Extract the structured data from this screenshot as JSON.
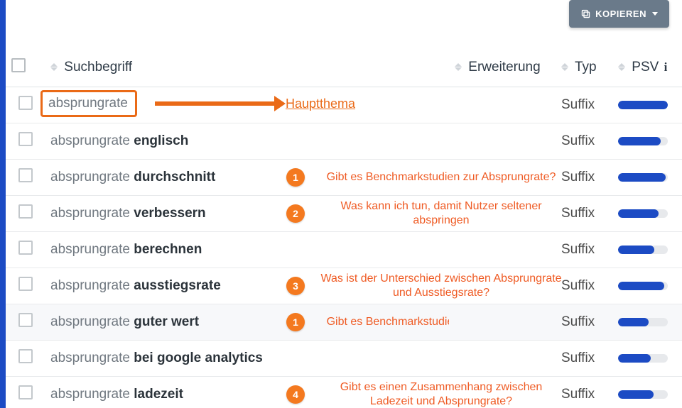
{
  "buttons": {
    "copy_label": "KOPIEREN"
  },
  "columns": {
    "search": "Suchbegriff",
    "ext": "Erweiterung",
    "typ": "Typ",
    "psv": "PSV"
  },
  "main_topic_label": "Hauptthema",
  "rows": [
    {
      "base": "absprungrate",
      "extra": "",
      "typ": "Suffix",
      "psv": 100,
      "annot_num": null,
      "annot_text": null,
      "highlight": true
    },
    {
      "base": "absprungrate",
      "extra": "englisch",
      "typ": "Suffix",
      "psv": 86,
      "annot_num": null,
      "annot_text": null
    },
    {
      "base": "absprungrate",
      "extra": "durchschnitt",
      "typ": "Suffix",
      "psv": 95,
      "annot_num": "1",
      "annot_text": "Gibt es Benchmarkstudien zur Absprungrate?"
    },
    {
      "base": "absprungrate",
      "extra": "verbessern",
      "typ": "Suffix",
      "psv": 82,
      "annot_num": "2",
      "annot_text": "Was kann ich tun, damit Nutzer seltener abspringen"
    },
    {
      "base": "absprungrate",
      "extra": "berechnen",
      "typ": "Suffix",
      "psv": 73,
      "annot_num": null,
      "annot_text": null
    },
    {
      "base": "absprungrate",
      "extra": "ausstiegsrate",
      "typ": "Suffix",
      "psv": 93,
      "annot_num": "3",
      "annot_text": "Was ist der Unterschied zwischen Absprungrate und Ausstiegsrate?"
    },
    {
      "base": "absprungrate",
      "extra": "guter wert",
      "typ": "Suffix",
      "psv": 62,
      "annot_num": "1",
      "annot_text": "Gibt es Benchmarkstudien zur Absprungrate?",
      "alt": true
    },
    {
      "base": "absprungrate",
      "extra": "bei google analytics",
      "typ": "Suffix",
      "psv": 66,
      "annot_num": null,
      "annot_text": null
    },
    {
      "base": "absprungrate",
      "extra": "ladezeit",
      "typ": "Suffix",
      "psv": 72,
      "annot_num": "4",
      "annot_text": "Gibt es einen Zusammenhang zwischen Ladezeit und Absprungrate?"
    }
  ]
}
